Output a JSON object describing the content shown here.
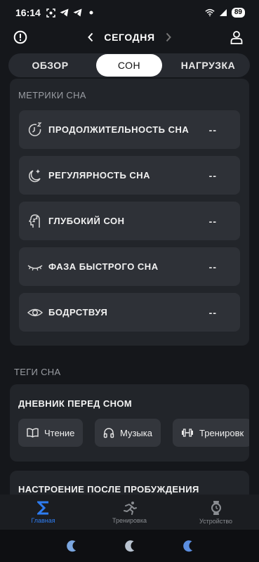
{
  "status_bar": {
    "time": "16:14",
    "battery": "89"
  },
  "header": {
    "date": "СЕГОДНЯ"
  },
  "tabs": [
    {
      "label": "ОБЗОР"
    },
    {
      "label": "СОН"
    },
    {
      "label": "НАГРУЗКА"
    }
  ],
  "metrics": {
    "title": "МЕТРИКИ СНА",
    "items": [
      {
        "label": "ПРОДОЛЖИТЕЛЬНОСТЬ СНА",
        "value": "--",
        "icon": "clock-zzz-icon"
      },
      {
        "label": "РЕГУЛЯРНОСТЬ СНА",
        "value": "--",
        "icon": "moon-stars-icon"
      },
      {
        "label": "ГЛУБОКИЙ СОН",
        "value": "--",
        "icon": "head-zzz-icon"
      },
      {
        "label": "ФАЗА БЫСТРОГО СНА",
        "value": "--",
        "icon": "closed-eye-icon"
      },
      {
        "label": "БОДРСТВУЯ",
        "value": "--",
        "icon": "eye-icon"
      }
    ]
  },
  "tags": {
    "title": "ТЕГИ СНА",
    "diary": {
      "title": "ДНЕВНИК ПЕРЕД СНОМ",
      "chips": [
        {
          "label": "Чтение",
          "icon": "book-icon"
        },
        {
          "label": "Музыка",
          "icon": "headphones-icon"
        },
        {
          "label": "Тренировк",
          "icon": "dumbbell-icon"
        }
      ]
    },
    "mood": {
      "title": "НАСТРОЕНИЕ ПОСЛЕ ПРОБУЖДЕНИЯ"
    }
  },
  "bottom_nav": [
    {
      "label": "Главная",
      "icon": "sigma-icon"
    },
    {
      "label": "Тренировка",
      "icon": "running-icon"
    },
    {
      "label": "Устройство",
      "icon": "watch-icon"
    }
  ],
  "colors": {
    "accent": "#2e7cf0",
    "background": "#15171b",
    "card": "#22252a",
    "row": "#2e3137"
  }
}
